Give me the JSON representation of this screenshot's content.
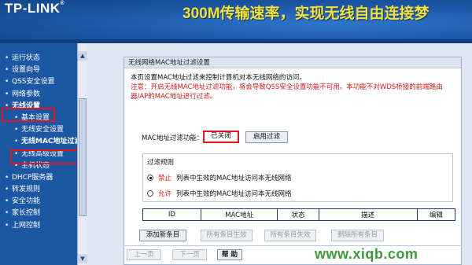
{
  "header": {
    "logo": "TP-LINK",
    "logo_reg": "®",
    "slogan": "300M传输速率，实现无线自由连接梦"
  },
  "sidebar": {
    "items": [
      {
        "label": "运行状态"
      },
      {
        "label": "设置向导"
      },
      {
        "label": "QSS安全设置"
      },
      {
        "label": "网络参数"
      },
      {
        "label": "无线设置"
      },
      {
        "label": "基本设置"
      },
      {
        "label": "无线安全设置"
      },
      {
        "label": "无线MAC地址过滤"
      },
      {
        "label": "无线高级设置"
      },
      {
        "label": "主机状态"
      },
      {
        "label": "DHCP服务器"
      },
      {
        "label": "转发规则"
      },
      {
        "label": "安全功能"
      },
      {
        "label": "家长控制"
      },
      {
        "label": "上网控制"
      }
    ],
    "bullet": "•",
    "scroll_up": "▲",
    "scroll_down": "▼"
  },
  "panel": {
    "title": "无线网络MAC地址过滤设置",
    "desc": "本页设置MAC地址过滤来控制计算机对本无线网络的访问。",
    "note": "注意：开启无线MAC地址过滤功能，将会导致QSS安全设置功能不可用。本功能不对WDS桥接的前端路由器/AP的MAC地址进行过滤。",
    "filter_label": "MAC地址过滤功能：",
    "filter_status": "已关闭",
    "enable_button": "启用过滤",
    "rules": {
      "title": "过滤规则",
      "deny_kw": "禁止",
      "deny_text": "列表中生效的MAC地址访问本无线网络",
      "allow_kw": "允许",
      "allow_text": "列表中生效的MAC地址访问本无线网络"
    },
    "table_headers": [
      "ID",
      "MAC地址",
      "状态",
      "描述",
      "编辑"
    ],
    "buttons": {
      "add": "添加新条目",
      "enable_all": "所有条目生效",
      "disable_all": "所有条目失效",
      "delete_all": "删除所有条目",
      "prev": "上一页",
      "next": "下一页",
      "help": "帮 助"
    }
  },
  "watermark": "www.xiqb.com"
}
